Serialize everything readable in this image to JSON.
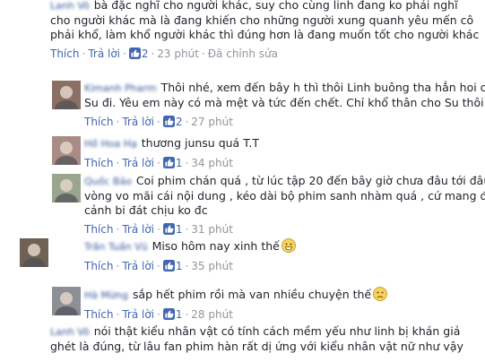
{
  "actions": {
    "like": "Thích",
    "reply": "Trả lời",
    "edited": "Đã chỉnh sửa"
  },
  "comments": [
    {
      "author": "Lanh Võ",
      "lines": [
        "bà đặc nghĩ cho người khác, suy cho cùng linh đang ko phải nghĩ",
        "cho người khác mà là đang khiến cho những người xung quanh yêu mến cô",
        "phải khổ, làm khổ người khác thì đúng hơn là đang muốn tốt cho người khác"
      ],
      "likes": "2",
      "time": "23 phút",
      "edited": true,
      "avatar_color": "#bfc3c7",
      "emoji": ""
    },
    {
      "author": "Kimanh Pharm",
      "lines": [
        "Thôi nhé, xem đến bây h thì thôi Linh buông tha hẳn hoi cho",
        "Su đi. Yêu em này có mà mệt và tức đến chết. Chỉ khổ thân cho Su thôi."
      ],
      "likes": "2",
      "time": "27 phút",
      "edited": false,
      "avatar_color": "#8a6f62",
      "emoji": ""
    },
    {
      "author": "Hồ Hoa Hạ",
      "lines": [
        "thương junsu quá T.T"
      ],
      "likes": "1",
      "time": "34 phút",
      "edited": false,
      "avatar_color": "#a98c86",
      "emoji": ""
    },
    {
      "author": "Quốc Bảo",
      "lines": [
        "Coi phim chán quá , từ lúc tập 20 đến bây giờ chưa đâu tới đâu cứ",
        "vòng vo mãi cái nội dung , kéo dài bộ phim sanh nhàm quá , cứ mang đến",
        "cảnh bi đát chịu ko đc"
      ],
      "likes": "1",
      "time": "31 phút",
      "edited": false,
      "avatar_color": "#9aa58f",
      "emoji": ""
    },
    {
      "author": "Trần Tuấn Vũ",
      "lines": [
        "Miso hôm nay xinh thế"
      ],
      "likes": "1",
      "time": "35 phút",
      "edited": false,
      "avatar_color": "#6f6255",
      "emoji": "grin"
    },
    {
      "author": "Hà Mừng",
      "lines": [
        "sắp hết phim rồi mà van nhiều chuyện thế"
      ],
      "likes": "1",
      "time": "28 phút",
      "edited": false,
      "avatar_color": "#8c8f94",
      "emoji": "sad"
    },
    {
      "author": "Lanh Võ",
      "lines": [
        "nói thật kiểu nhân vật có tính cách mềm yếu như linh bị khán giả",
        "ghét là đúng, từ lâu fan phim hàn rất dị ứng với kiểu nhân vật nữ như vậy"
      ],
      "likes": "",
      "time": "",
      "edited": false,
      "avatar_color": "#bfc3c7",
      "emoji": ""
    }
  ],
  "colors": {
    "link": "#4267b2",
    "meta": "#90949c",
    "text": "#1d2129",
    "author": "#365899"
  }
}
